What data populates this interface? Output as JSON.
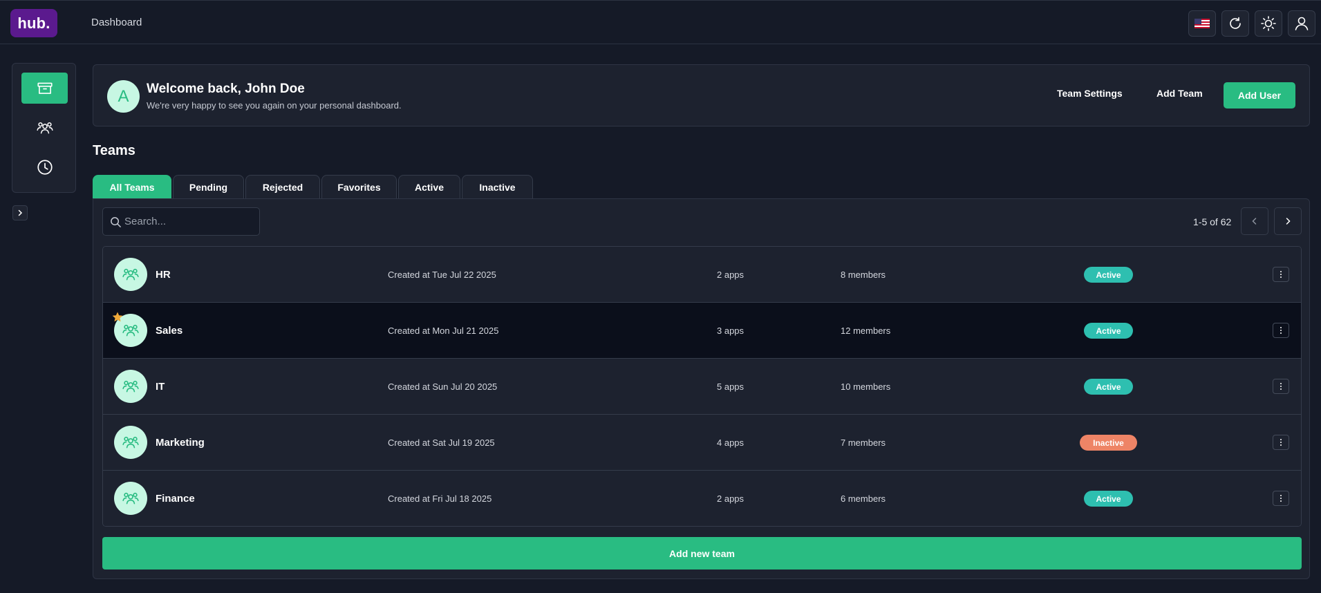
{
  "header": {
    "logo": "hub.",
    "nav_title": "Dashboard",
    "actions": [
      {
        "name": "language-flag-us-icon"
      },
      {
        "name": "refresh-icon"
      },
      {
        "name": "sun-icon"
      },
      {
        "name": "user-icon"
      }
    ]
  },
  "sidebar": {
    "items": [
      {
        "icon": "archive-box-icon",
        "active": true
      },
      {
        "icon": "users-group-icon",
        "active": false
      },
      {
        "icon": "clock-icon",
        "active": false
      }
    ],
    "expand_icon": "chevron-right-icon"
  },
  "welcome": {
    "avatar_letter": "A",
    "title": "Welcome back, John Doe",
    "subtitle": "We're very happy to see you again on your personal dashboard.",
    "team_settings_label": "Team Settings",
    "add_team_label": "Add Team",
    "add_user_label": "Add User"
  },
  "teams_section": {
    "title": "Teams",
    "tabs": [
      {
        "label": "All Teams",
        "active": true
      },
      {
        "label": "Pending",
        "active": false
      },
      {
        "label": "Rejected",
        "active": false
      },
      {
        "label": "Favorites",
        "active": false
      },
      {
        "label": "Active",
        "active": false
      },
      {
        "label": "Inactive",
        "active": false
      }
    ],
    "search": {
      "placeholder": "Search...",
      "value": ""
    },
    "pagination": {
      "text": "1-5 of 62"
    },
    "rows": [
      {
        "name": "HR",
        "created": "Created at Tue Jul 22 2025",
        "apps": "2 apps",
        "members": "8 members",
        "status": "Active",
        "favorite": false
      },
      {
        "name": "Sales",
        "created": "Created at Mon Jul 21 2025",
        "apps": "3 apps",
        "members": "12 members",
        "status": "Active",
        "favorite": true
      },
      {
        "name": "IT",
        "created": "Created at Sun Jul 20 2025",
        "apps": "5 apps",
        "members": "10 members",
        "status": "Active",
        "favorite": false
      },
      {
        "name": "Marketing",
        "created": "Created at Sat Jul 19 2025",
        "apps": "4 apps",
        "members": "7 members",
        "status": "Inactive",
        "favorite": false
      },
      {
        "name": "Finance",
        "created": "Created at Fri Jul 18 2025",
        "apps": "2 apps",
        "members": "6 members",
        "status": "Active",
        "favorite": false
      }
    ],
    "add_new_label": "Add new team"
  },
  "colors": {
    "accent": "#29bc82",
    "background": "#151a27",
    "card": "#1d222f",
    "status_active": "#2ebfb0",
    "status_inactive": "#ee8466",
    "logo_bg": "#5b1a8e"
  }
}
